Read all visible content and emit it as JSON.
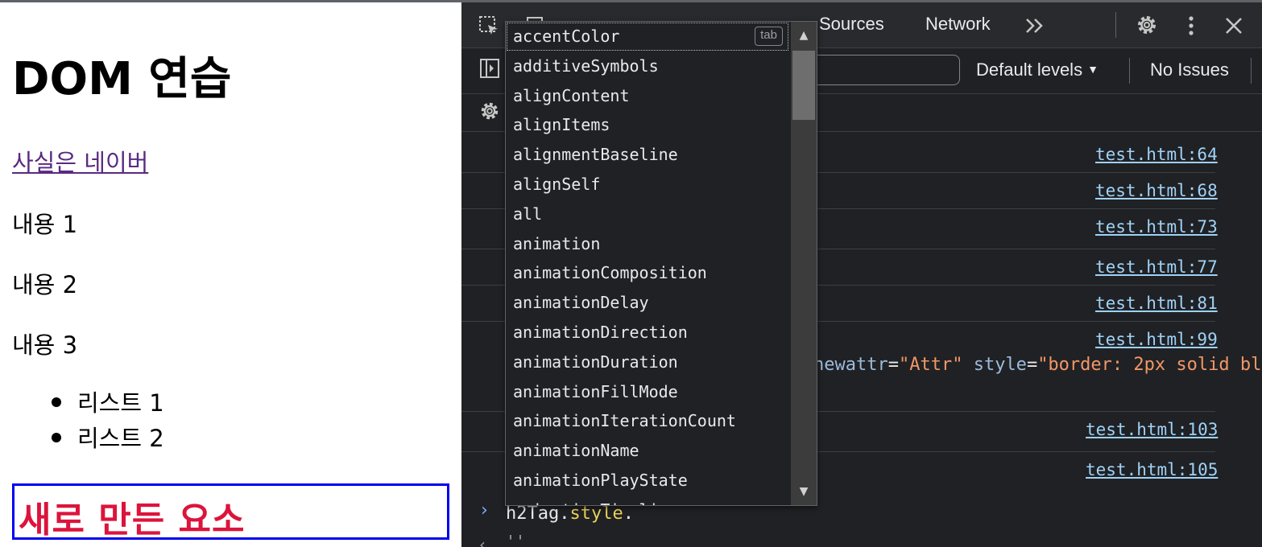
{
  "page": {
    "heading": "DOM 연습",
    "link_text": "사실은 네이버",
    "paragraphs": [
      "내용 1",
      "내용 2",
      "내용 3"
    ],
    "list_items": [
      "리스트 1",
      "리스트 2"
    ],
    "new_element_text": "새로 만든 요소"
  },
  "devtools": {
    "tabs": [
      "Sources",
      "Network"
    ],
    "more_tabs_icon": "chevron-double-right-icon",
    "filter_levels": "Default levels",
    "issues": "No Issues",
    "log_links": [
      "test.html:64",
      "test.html:68",
      "test.html:73",
      "test.html:77",
      "test.html:81",
      "test.html:99",
      "test.html:103",
      "test.html:105"
    ],
    "code_fragment": {
      "attr1": "newattr",
      "val1": "\"Attr\"",
      "attr2": "style",
      "val2": "\"border: 2px solid bl"
    },
    "prompt": {
      "object": "h2Tag",
      "property": "style",
      "dot": "."
    },
    "result_text": "''"
  },
  "autocomplete": {
    "tab_hint": "tab",
    "items": [
      "accentColor",
      "additiveSymbols",
      "alignContent",
      "alignItems",
      "alignmentBaseline",
      "alignSelf",
      "all",
      "animation",
      "animationComposition",
      "animationDelay",
      "animationDirection",
      "animationDuration",
      "animationFillMode",
      "animationIterationCount",
      "animationName",
      "animationPlayState",
      "animationTimeline"
    ]
  },
  "colors": {
    "link": "#5a2a82",
    "new_element_text": "#dc143c",
    "new_element_border": "#0000ee",
    "devtools_bg": "#202124",
    "source_link": "#9fd2f7"
  }
}
